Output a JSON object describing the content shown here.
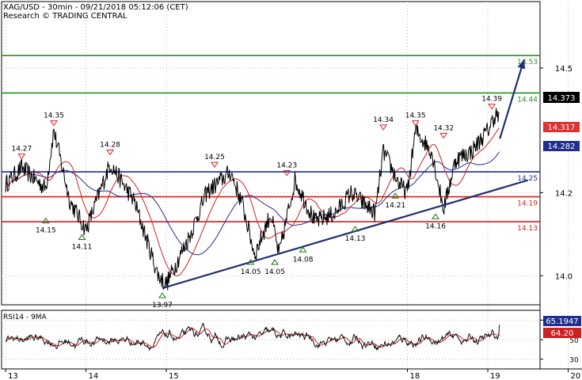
{
  "header": {
    "title": "XAG/USD - 30min - 09/21/2018 05:12:06 (CET)",
    "source": "Research © TRADING CENTRAL"
  },
  "rsi_panel": {
    "label": "RSI14 - 9MA",
    "ylim": [
      20,
      80
    ],
    "yticks": [
      30,
      50,
      70
    ],
    "last_rsi": "65.1947",
    "last_ma": "64.20",
    "rsi_color": "#111111",
    "ma_color": "#cc2222",
    "badge_color": "#1f2f8f"
  },
  "chart_data": {
    "type": "line",
    "title": "XAG/USD - 30min - 09/21/2018 05:12:06 (CET)",
    "ylim": [
      13.93,
      14.66
    ],
    "yticks": [
      14.0,
      14.2,
      14.5
    ],
    "xticks": [
      "13",
      "14",
      "15",
      "18",
      "19",
      "20",
      "21"
    ],
    "price_path": [
      [
        13.0,
        14.22
      ],
      [
        13.2,
        14.26
      ],
      [
        13.5,
        14.21
      ],
      [
        13.6,
        14.35
      ],
      [
        13.8,
        14.18
      ],
      [
        14.0,
        14.11
      ],
      [
        14.3,
        14.27
      ],
      [
        14.6,
        14.18
      ],
      [
        14.9,
        14.0
      ],
      [
        15.0,
        13.98
      ],
      [
        15.3,
        14.1
      ],
      [
        15.5,
        14.2
      ],
      [
        15.8,
        14.25
      ],
      [
        15.95,
        14.17
      ],
      [
        16.1,
        14.05
      ],
      [
        16.3,
        14.15
      ],
      [
        16.4,
        14.05
      ],
      [
        16.6,
        14.23
      ],
      [
        16.85,
        14.13
      ],
      [
        17.1,
        14.15
      ],
      [
        17.3,
        14.2
      ],
      [
        17.6,
        14.15
      ],
      [
        17.7,
        14.3
      ],
      [
        17.9,
        14.22
      ],
      [
        18.0,
        14.2
      ],
      [
        18.1,
        14.35
      ],
      [
        18.3,
        14.3
      ],
      [
        18.45,
        14.16
      ],
      [
        18.6,
        14.28
      ],
      [
        18.8,
        14.3
      ],
      [
        19.0,
        14.35
      ],
      [
        19.1,
        14.39
      ],
      [
        19.15,
        14.373
      ]
    ],
    "series": [
      {
        "name": "price",
        "color": "#000000"
      },
      {
        "name": "ma-fast",
        "color": "#cc2222"
      },
      {
        "name": "ma-slow",
        "color": "#1f2f8f"
      }
    ],
    "horizontal_levels": [
      {
        "value": 14.53,
        "label": "14.53",
        "color": "#2e8b2e"
      },
      {
        "value": 14.44,
        "label": "14.44",
        "color": "#2e8b2e"
      },
      {
        "value": 14.25,
        "label": "14.25",
        "color": "#1f2f8f"
      },
      {
        "value": 14.19,
        "label": "14.19",
        "color": "#d62020"
      },
      {
        "value": 14.13,
        "label": "14.13",
        "color": "#d62020"
      }
    ],
    "trendline": {
      "from": [
        14.95,
        13.97
      ],
      "to": [
        19.5,
        14.23
      ],
      "color": "#1f2f6f"
    },
    "projection_arrow": {
      "from": [
        19.15,
        14.33
      ],
      "to": [
        19.45,
        14.52
      ],
      "color": "#1f2f6f"
    },
    "highs": [
      {
        "x": 13.2,
        "value": "14.27"
      },
      {
        "x": 13.6,
        "value": "14.35"
      },
      {
        "x": 14.3,
        "value": "14.28"
      },
      {
        "x": 15.6,
        "value": "14.25"
      },
      {
        "x": 16.5,
        "value": "14.23"
      },
      {
        "x": 17.7,
        "value": "14.34"
      },
      {
        "x": 18.1,
        "value": "14.35"
      },
      {
        "x": 18.45,
        "value": "14.32"
      },
      {
        "x": 19.05,
        "value": "14.39"
      }
    ],
    "lows": [
      {
        "x": 13.5,
        "value": "14.15"
      },
      {
        "x": 13.95,
        "value": "14.11"
      },
      {
        "x": 14.95,
        "value": "13.97"
      },
      {
        "x": 16.05,
        "value": "14.05"
      },
      {
        "x": 16.35,
        "value": "14.05"
      },
      {
        "x": 16.7,
        "value": "14.08"
      },
      {
        "x": 17.35,
        "value": "14.13"
      },
      {
        "x": 17.85,
        "value": "14.21"
      },
      {
        "x": 18.35,
        "value": "14.16"
      }
    ],
    "current_price": {
      "value": "14.373",
      "color": "#000000"
    },
    "price_badges": [
      {
        "value": "14.317",
        "color": "#e03030"
      },
      {
        "value": "14.282",
        "color": "#1f2f8f"
      }
    ]
  }
}
